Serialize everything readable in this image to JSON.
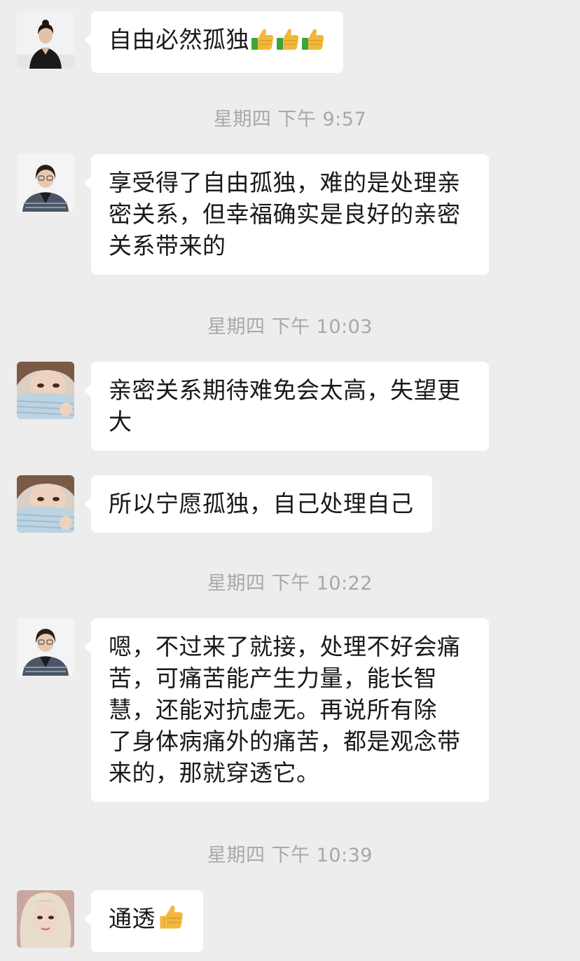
{
  "messages": [
    {
      "sender": "woman-in-black-suit",
      "text": "自由必然孤独",
      "emoji": [
        "thumbs-up",
        "thumbs-up",
        "thumbs-up"
      ]
    },
    {
      "sender": "woman-with-glasses",
      "lines": [
        "享受得了自由孤独，难的是处理亲",
        "密关系，但幸福确实是良好的亲密",
        "关系带来的"
      ]
    },
    {
      "sender": "woman-with-knit-scarf",
      "lines": [
        "亲密关系期待难免会太高，失望更",
        "大"
      ]
    },
    {
      "sender": "woman-with-knit-scarf",
      "text": "所以宁愿孤独，自己处理自己"
    },
    {
      "sender": "woman-with-glasses",
      "lines": [
        "嗯，不过来了就接，处理不好会痛",
        "苦，可痛苦能产生力量，能长智",
        "慧，还能对抗虚无。再说所有除",
        "了身体病痛外的痛苦，都是观念带",
        "来的，那就穿透它。"
      ]
    },
    {
      "sender": "blonde-woman",
      "text": "通透",
      "emoji": [
        "thumbs-up"
      ]
    }
  ],
  "timestamps": [
    "星期四 下午 9:57",
    "星期四 下午 10:03",
    "星期四 下午 10:22",
    "星期四 下午 10:39"
  ],
  "colors": {
    "background": "#ededed",
    "bubble": "#ffffff",
    "timestamp": "#a8a8a8",
    "text": "#191919"
  }
}
